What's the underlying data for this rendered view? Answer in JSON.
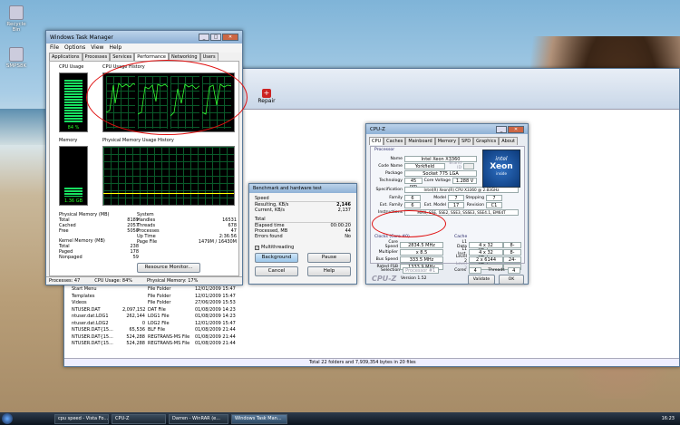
{
  "desktop": {
    "icons": [
      {
        "label": "Recycle Bin"
      },
      {
        "label": "SMPS8K"
      }
    ]
  },
  "taskmgr": {
    "title": "Windows Task Manager",
    "menu": [
      "File",
      "Options",
      "View",
      "Help"
    ],
    "tabs": [
      "Applications",
      "Processes",
      "Services",
      "Performance",
      "Networking",
      "Users"
    ],
    "cpu_usage_label": "CPU Usage",
    "cpu_value": "84 %",
    "cpu_history_label": "CPU Usage History",
    "memory_label": "Memory",
    "mem_value": "1.36 GB",
    "mem_history_label": "Physical Memory Usage History",
    "phys": {
      "header": "Physical Memory (MB)",
      "rows": [
        [
          "Total",
          "8189"
        ],
        [
          "Cached",
          "2057"
        ],
        [
          "Free",
          "5050"
        ]
      ]
    },
    "kernel": {
      "header": "Kernel Memory (MB)",
      "rows": [
        [
          "Total",
          "238"
        ],
        [
          "Paged",
          "178"
        ],
        [
          "Nonpaged",
          "59"
        ]
      ]
    },
    "system": {
      "header": "System",
      "rows": [
        [
          "Handles",
          "16531"
        ],
        [
          "Threads",
          "678"
        ],
        [
          "Processes",
          "47"
        ],
        [
          "Up Time",
          "2:36:56"
        ],
        [
          "Page File",
          "1479M / 16430M"
        ]
      ]
    },
    "resource_btn": "Resource Monitor...",
    "status": {
      "processes": "Processes: 47",
      "cpu": "CPU Usage: 84%",
      "mem": "Physical Memory: 17%"
    }
  },
  "winrar": {
    "repair": "Repair",
    "status": "Total 22 folders and 7,939,354 bytes in 20 files",
    "files": [
      [
        "Start Menu",
        "",
        "File Folder",
        "12/01/2009 15:47"
      ],
      [
        "Templates",
        "",
        "File Folder",
        "12/01/2009 15:47"
      ],
      [
        "Videos",
        "",
        "File Folder",
        "27/06/2009 15:53"
      ],
      [
        "NTUSER.DAT",
        "2,097,152",
        "DAT File",
        "01/08/2009 14:23"
      ],
      [
        "ntuser.dat.LOG1",
        "262,144",
        "LOG1 File",
        "01/08/2009 14:23"
      ],
      [
        "ntuser.dat.LOG2",
        "0",
        "LOG2 File",
        "12/01/2009 15:47"
      ],
      [
        "NTUSER.DAT{15...",
        "65,536",
        "BLF File",
        "01/08/2009 21:44"
      ],
      [
        "NTUSER.DAT{15...",
        "524,288",
        "REGTRANS-MS File",
        "01/08/2009 21:44"
      ],
      [
        "NTUSER.DAT{15...",
        "524,288",
        "REGTRANS-MS File",
        "01/08/2009 21:44"
      ]
    ]
  },
  "bench": {
    "title": "Benchmark and hardware test",
    "speed_header": "Speed",
    "speed_rows": [
      [
        "Resulting, KB/s",
        "2,146"
      ],
      [
        "Current, KB/s",
        "2,137"
      ]
    ],
    "total_header": "Total",
    "total_rows": [
      [
        "Elapsed time",
        "00:00:20"
      ],
      [
        "Processed, MB",
        "44"
      ],
      [
        "Errors found",
        "No"
      ]
    ],
    "multithreading": "Multithreading",
    "buttons": [
      "Background",
      "Pause",
      "Cancel",
      "Help"
    ]
  },
  "cpuz": {
    "title": "CPU-Z",
    "tabs": [
      "CPU",
      "Caches",
      "Mainboard",
      "Memory",
      "SPD",
      "Graphics",
      "About"
    ],
    "processor_header": "Processor",
    "name_label": "Name",
    "name": "Intel Xeon X3360",
    "codename_label": "Code Name",
    "codename": "Yorkfield",
    "brandid_label": "Brand ID",
    "package_label": "Package",
    "package": "Socket 775 LGA",
    "tech_label": "Technology",
    "tech": "45 nm",
    "cv_label": "Core Voltage",
    "cv": "1.288 V",
    "spec_label": "Specification",
    "spec": "Intel(R) Xeon(R) CPU   X3360  @ 2.83GHz",
    "family_label": "Family",
    "family": "6",
    "model_label": "Model",
    "model": "7",
    "stepping_label": "Stepping",
    "stepping": "7",
    "extfam_label": "Ext. Family",
    "extfam": "6",
    "extmodel_label": "Ext. Model",
    "extmodel": "17",
    "rev_label": "Revision",
    "rev": "C1",
    "instr_label": "Instructions",
    "instr": "MMX, SSE, SSE2, SSE3, SSSE3, SSE4.1, EM64T",
    "clocks_header": "Clocks (Core #0)",
    "cache_header": "Cache",
    "core_speed_label": "Core Speed",
    "core_speed": "2834.5 MHz",
    "mult_label": "Multiplier",
    "mult": "x 8.5",
    "bus_label": "Bus Speed",
    "bus": "333.5 MHz",
    "fsb_label": "Rated FSB",
    "fsb": "1333.9 MHz",
    "l1d_label": "L1 Data",
    "l1d": "4 x 32 KBytes",
    "l1d_w": "8-way",
    "l1i_label": "L1 Inst.",
    "l1i": "4 x 32 KBytes",
    "l1i_w": "8-way",
    "l2_label": "Level 2",
    "l2": "2 x 6144 KBytes",
    "l2_w": "24-way",
    "l3_label": "Level 3",
    "selection_label": "Selection",
    "selection": "Processor #1",
    "cores_label": "Cores",
    "cores": "4",
    "threads_label": "Threads",
    "threads": "4",
    "logo": "CPU-Z",
    "version": "Version 1.52",
    "validate": "Validate",
    "ok": "OK",
    "badge_intel": "intel",
    "badge_xeon": "Xeon",
    "badge_inside": "inside"
  },
  "taskbar": {
    "items": [
      "cpu speed - Vista Fo...",
      "CPU-Z",
      "Darren - WinRAR (e...",
      "Windows Task Man..."
    ],
    "clock": "16:23"
  }
}
